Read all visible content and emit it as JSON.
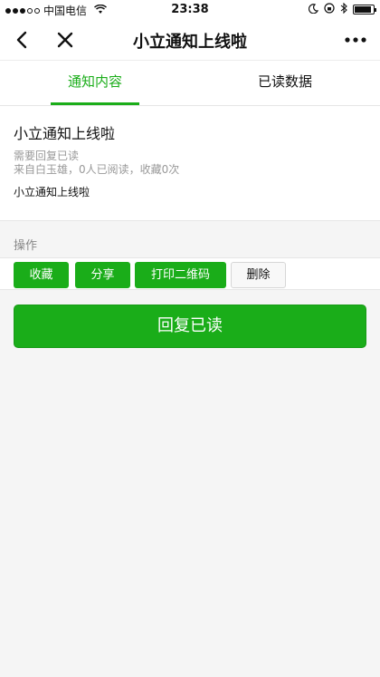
{
  "status_bar": {
    "carrier": "中国电信",
    "time": "23:38",
    "signal_bars_filled": 3,
    "signal_bars_total": 5,
    "battery_level": 0.9,
    "icons": [
      "signal-icon",
      "wifi-icon",
      "moon-icon",
      "lock-rotation-icon",
      "bluetooth-icon",
      "battery-icon"
    ]
  },
  "nav": {
    "title": "小立通知上线啦",
    "back_icon": "chevron-left-icon",
    "close_icon": "close-icon",
    "more_icon": "more-icon"
  },
  "tabs": [
    {
      "label": "通知内容",
      "active": true
    },
    {
      "label": "已读数据",
      "active": false
    }
  ],
  "notice": {
    "title": "小立通知上线啦",
    "requirement": "需要回复已读",
    "source": "来自白玉雄，0人已阅读，收藏0次",
    "body": "小立通知上线啦"
  },
  "actions": {
    "section_label": "操作",
    "buttons": [
      {
        "label": "收藏",
        "style": "green"
      },
      {
        "label": "分享",
        "style": "green"
      },
      {
        "label": "打印二维码",
        "style": "green"
      },
      {
        "label": "删除",
        "style": "default"
      }
    ],
    "reply_label": "回复已读"
  },
  "colors": {
    "accent": "#1aad19",
    "background": "#f5f5f5",
    "muted_text": "#999999"
  }
}
